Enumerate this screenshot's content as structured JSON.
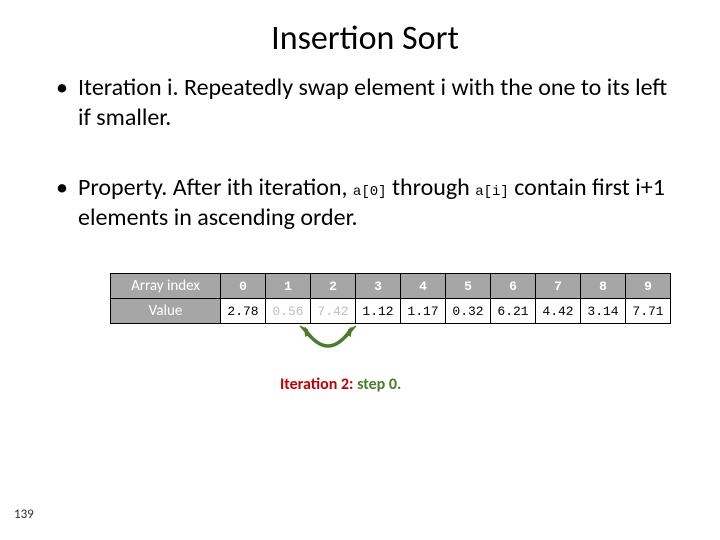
{
  "title": "Insertion Sort",
  "bullets": {
    "b1_pre": "Iteration i.  Repeatedly swap element i with the one to its left if smaller.",
    "b2_a": "Property.  After ith iteration, ",
    "b2_code1": "a[0]",
    "b2_b": " through ",
    "b2_code2": "a[i]",
    "b2_c": " contain first i+1 elements in ascending order."
  },
  "table": {
    "row1_label": "Array index",
    "row2_label": "Value",
    "indices": [
      "0",
      "1",
      "2",
      "3",
      "4",
      "5",
      "6",
      "7",
      "8",
      "9"
    ],
    "values": [
      "2.78",
      "0.56",
      "7.42",
      "1.12",
      "1.17",
      "0.32",
      "6.21",
      "4.42",
      "3.14",
      "7.71"
    ],
    "grey_cols": [
      1,
      2
    ]
  },
  "iteration": {
    "label_a": "Iteration 2:",
    "label_b": "  step 0."
  },
  "page_number": "139"
}
